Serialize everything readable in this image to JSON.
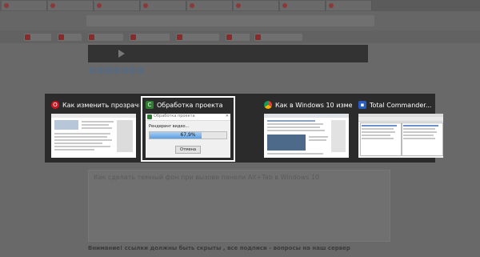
{
  "switcher": {
    "windows": [
      {
        "title": "Как изменить прозрачн...",
        "app": "Opera",
        "icon": "opera-icon",
        "icon_color": "#d0141f",
        "selected": false
      },
      {
        "title": "Обработка проекта",
        "app": "Camtasia",
        "icon": "camtasia-icon",
        "icon_color": "#2e7d32",
        "selected": true
      },
      {
        "title": "Как в Windows 10 измен...",
        "app": "Chrome",
        "icon": "chrome-icon",
        "icon_color": "#e8b400",
        "selected": false
      },
      {
        "title": "Total Commander...",
        "app": "Total Commander",
        "icon": "floppy-disk-icon",
        "icon_color": "#2a5bbf",
        "selected": false
      }
    ],
    "dialog": {
      "title": "Обработка проекта",
      "label": "Рендеринг видео...",
      "progress": 0.679,
      "progress_text": "67,9%",
      "cancel_label": "Отмена"
    }
  },
  "background": {
    "textarea_text": "Как сделать темный фон при вызове панели Alt+Tab в Windows 10",
    "bottom_text": "Внимание! ссылки должны быть скрыты , все подписи - вопросы на наш сервер"
  }
}
